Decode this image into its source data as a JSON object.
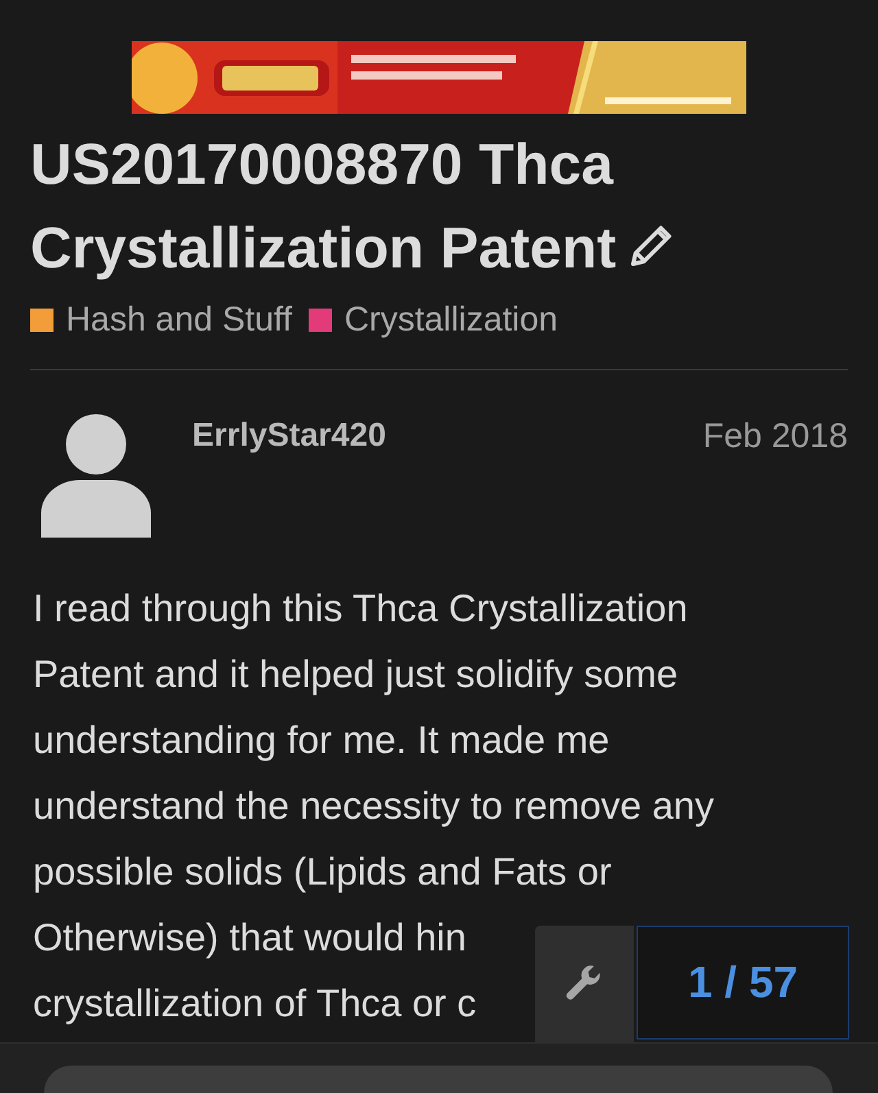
{
  "topic": {
    "title": "US20170008870 Thca Crystallization Patent",
    "categories": [
      {
        "name": "Hash and Stuff",
        "color": "#f29c3a"
      },
      {
        "name": "Crystallization",
        "color": "#e33a7a"
      }
    ]
  },
  "post": {
    "author": "ErrlyStar420",
    "date": "Feb 2018",
    "lines": [
      "I read through this Thca Crystallization",
      "Patent and it helped just solidify some",
      "understanding for me. It made me",
      "understand the necessity to remove any",
      "possible solids (Lipids and Fats or",
      "Otherwise) that would hin",
      "crystallization of Thca or c"
    ]
  },
  "progress": {
    "counter": "1 / 57"
  }
}
